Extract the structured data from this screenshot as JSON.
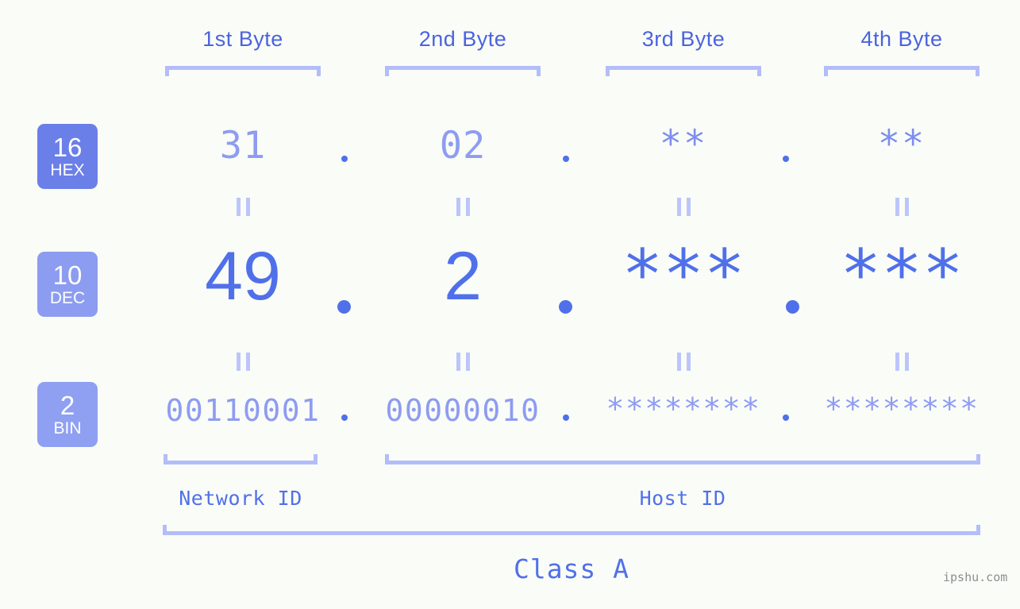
{
  "background_color": "#fafdf7",
  "accent_color": "#5070ea",
  "muted_accent_color": "#8e9cf2",
  "bracket_color": "#b3bdfa",
  "headers": [
    {
      "label": "1st Byte"
    },
    {
      "label": "2nd Byte"
    },
    {
      "label": "3rd Byte"
    },
    {
      "label": "4th Byte"
    }
  ],
  "bases": [
    {
      "num": "16",
      "name": "HEX",
      "badge_color": "#6b7fe8"
    },
    {
      "num": "10",
      "name": "DEC",
      "badge_color": "#8c9cf0"
    },
    {
      "num": "2",
      "name": "BIN",
      "badge_color": "#8fa0f2"
    }
  ],
  "rows": {
    "hex": {
      "base": "HEX",
      "values": [
        "31",
        "02",
        "**",
        "**"
      ],
      "separator": "."
    },
    "dec": {
      "base": "DEC",
      "values": [
        "49",
        "2",
        "***",
        "***"
      ],
      "separator": "."
    },
    "bin": {
      "base": "BIN",
      "values": [
        "00110001",
        "00000010",
        "********",
        "********"
      ],
      "separator": "."
    }
  },
  "equals_mark": "||",
  "footer": {
    "network_id_label": "Network ID",
    "host_id_label": "Host ID",
    "class_label": "Class A",
    "watermark": "ipshu.com"
  }
}
